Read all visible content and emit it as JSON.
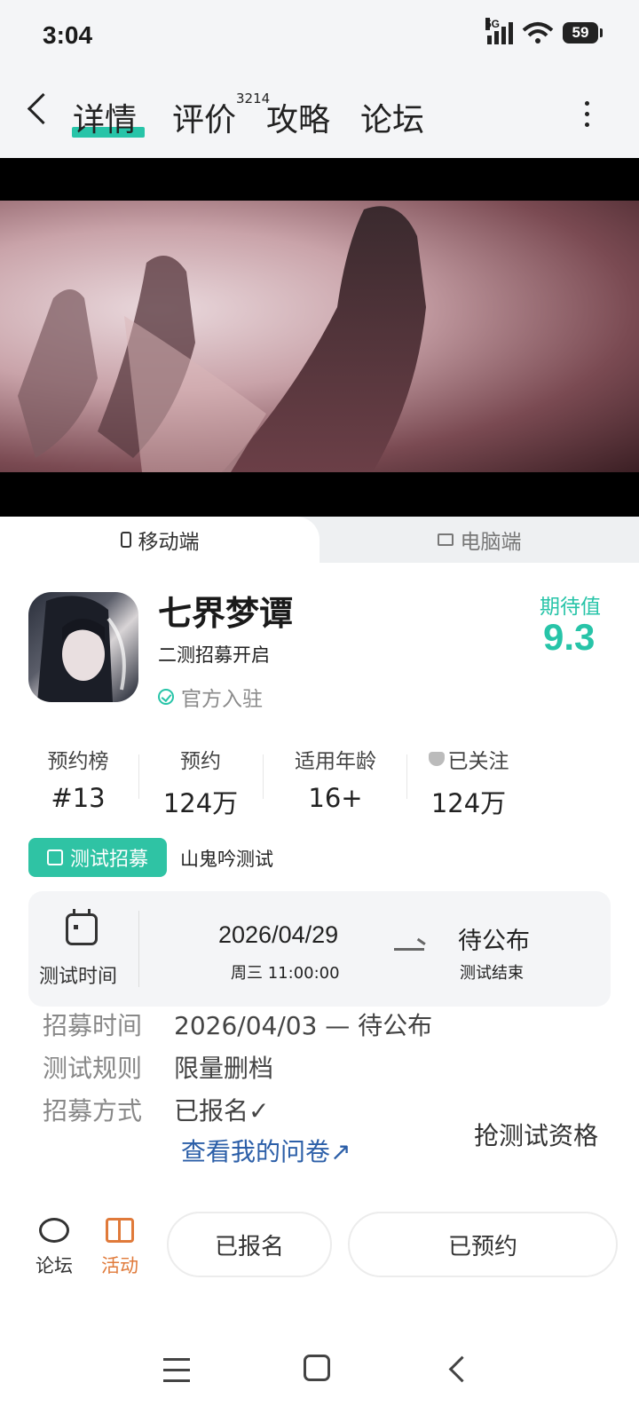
{
  "status_bar": {
    "time": "3:04",
    "network": "5G",
    "battery": "59"
  },
  "nav": {
    "tabs": [
      {
        "label": "详情",
        "active": true
      },
      {
        "label": "评价",
        "count": "3214"
      },
      {
        "label": "攻略"
      },
      {
        "label": "论坛"
      }
    ]
  },
  "platform": {
    "mobile": "移动端",
    "pc": "电脑端"
  },
  "game": {
    "title": "七界梦谭",
    "subtitle": "二测招募开启",
    "official": "官方入驻",
    "expect_label": "期待值",
    "expect_value": "9.3"
  },
  "stats": [
    {
      "label": "预约榜",
      "value": "#13"
    },
    {
      "label": "预约",
      "value": "124万"
    },
    {
      "label": "适用年龄",
      "value": "16+"
    },
    {
      "label": "已关注",
      "value": "124万"
    }
  ],
  "recruit": {
    "tag": "测试招募",
    "name": "山鬼吟测试",
    "time_label": "测试时间",
    "start_date": "2026/04/29",
    "start_week_time": "周三  11:00:00",
    "end_status": "待公布",
    "end_label": "测试结束"
  },
  "details": {
    "recruit_time_key": "招募时间",
    "recruit_time_value": "2026/04/03 — 待公布",
    "rule_key": "测试规则",
    "rule_value": "限量删档",
    "method_key": "招募方式",
    "method_value": "已报名✓",
    "grab": "抢测试资格",
    "questionnaire": "查看我的问卷↗"
  },
  "bottom": {
    "forum": "论坛",
    "activity": "活动",
    "signed_up": "已报名",
    "reserved": "已预约"
  },
  "colors": {
    "accent": "#27c4a8",
    "link": "#2c5fa8",
    "activity": "#e07a3a"
  }
}
